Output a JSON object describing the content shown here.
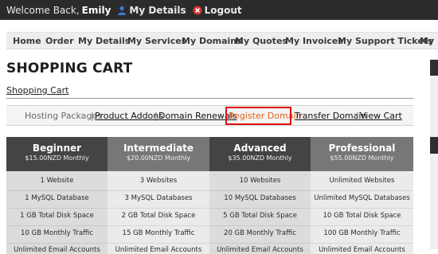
{
  "topbar": {
    "welcome": "Welcome Back,",
    "user": "Emily",
    "my_details": "My Details",
    "logout": "Logout"
  },
  "nav": [
    "Home",
    "Order",
    "My Details",
    "My Services",
    "My Domains",
    "My Quotes",
    "My Invoices",
    "My Support Tickets",
    "My Em"
  ],
  "page_title": "SHOPPING CART",
  "breadcrumb": "Shopping Cart",
  "subnav": {
    "hosting": "Hosting Packages",
    "addons": "Product Addons",
    "renewals": "Domain Renewals",
    "register": "Register Domain",
    "transfer": "Transfer Domain",
    "cart": "View Cart",
    "sep": "|"
  },
  "plans": [
    {
      "name": "Beginner",
      "price": "$15.00NZD Monthly",
      "features": [
        "1 Website",
        "1 MySQL Database",
        "1 GB Total Disk Space",
        "10 GB Monthly Traffic",
        "Unlimited Email Accounts"
      ]
    },
    {
      "name": "Intermediate",
      "price": "$20.00NZD Monthly",
      "features": [
        "3 Websites",
        "3 MySQL Databases",
        "2 GB Total Disk Space",
        "15 GB Monthly Traffic",
        "Unlimited Email Accounts"
      ]
    },
    {
      "name": "Advanced",
      "price": "$35.00NZD Monthly",
      "features": [
        "10 Websites",
        "10 MySQL Databases",
        "5 GB Total Disk Space",
        "20 GB Monthly Traffic",
        "Unlimited Email Accounts"
      ]
    },
    {
      "name": "Professional",
      "price": "$55.00NZD Monthly",
      "features": [
        "Unlimited Websites",
        "Unlimited MySQL Databases",
        "10 GB Total Disk Space",
        "100 GB Monthly Traffic",
        "Unlimited Email Accounts"
      ]
    }
  ]
}
